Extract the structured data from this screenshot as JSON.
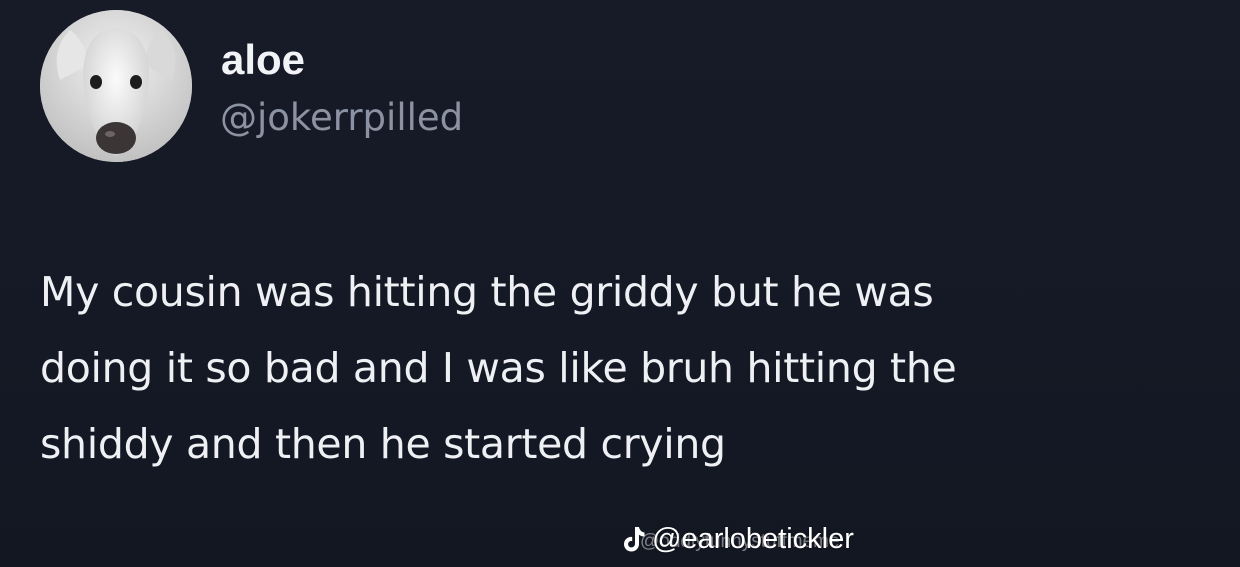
{
  "tweet": {
    "display_name": "aloe",
    "handle": "@jokerrpilled",
    "avatar_icon": "dog-avatar",
    "body_lines": [
      "My cousin was hitting the griddy but he was",
      "doing it so bad and I was like bruh hitting the",
      "shiddy and then he started crying"
    ]
  },
  "watermark": {
    "icon": "tiktok-icon",
    "text": "@earlobetickler",
    "ghost_text": "@oddlyfunnystuffmeme"
  },
  "colors": {
    "background": "#161a26",
    "text": "#eef0f4",
    "handle": "#8b93a3"
  }
}
